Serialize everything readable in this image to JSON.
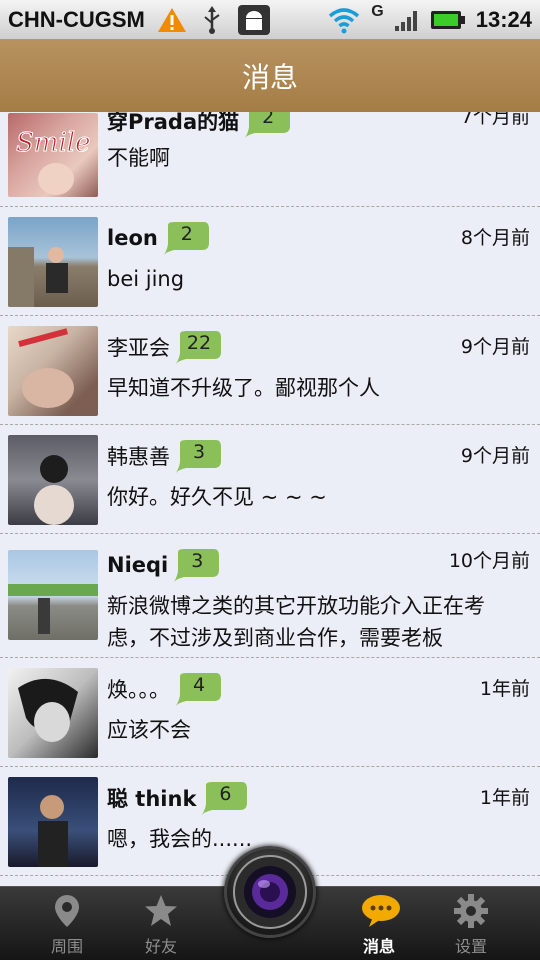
{
  "status_bar": {
    "carrier": "CHN-CUGSM",
    "network_type": "G",
    "time": "13:24",
    "icons": [
      "warning-icon",
      "usb-icon",
      "android-debug-icon",
      "wifi-icon",
      "signal-icon",
      "battery-icon"
    ]
  },
  "header": {
    "title": "消息"
  },
  "conversations": [
    {
      "name": "穿Prada的猫",
      "count": "2",
      "time": "7个月前",
      "message": "不能啊"
    },
    {
      "name": "leon",
      "count": "2",
      "time": "8个月前",
      "message": "bei jing"
    },
    {
      "name": "李亚会",
      "count": "22",
      "time": "9个月前",
      "message": "早知道不升级了。鄙视那个人"
    },
    {
      "name": "韩惠善",
      "count": "3",
      "time": "9个月前",
      "message": "你好。好久不见 ~ ~ ~"
    },
    {
      "name": "Nieqi",
      "count": "3",
      "time": "10个月前",
      "message": "新浪微博之类的其它开放功能介入正在考虑，不过涉及到商业合作，需要老板"
    },
    {
      "name": "焕。。。",
      "count": "4",
      "time": "1年前",
      "message": "应该不会"
    },
    {
      "name": "聪 think",
      "count": "6",
      "time": "1年前",
      "message": "嗯，我会的......"
    }
  ],
  "tabs": [
    {
      "label": "周围",
      "icon": "location-pin-icon"
    },
    {
      "label": "好友",
      "icon": "star-icon"
    },
    {
      "label": "消息",
      "icon": "chat-bubble-icon",
      "active": true
    },
    {
      "label": "设置",
      "icon": "gear-icon"
    }
  ],
  "colors": {
    "header_bg": "#a8804a",
    "list_bg": "#eceef7",
    "bubble_green": "#8bbf5a",
    "tab_active": "#f2a900"
  }
}
